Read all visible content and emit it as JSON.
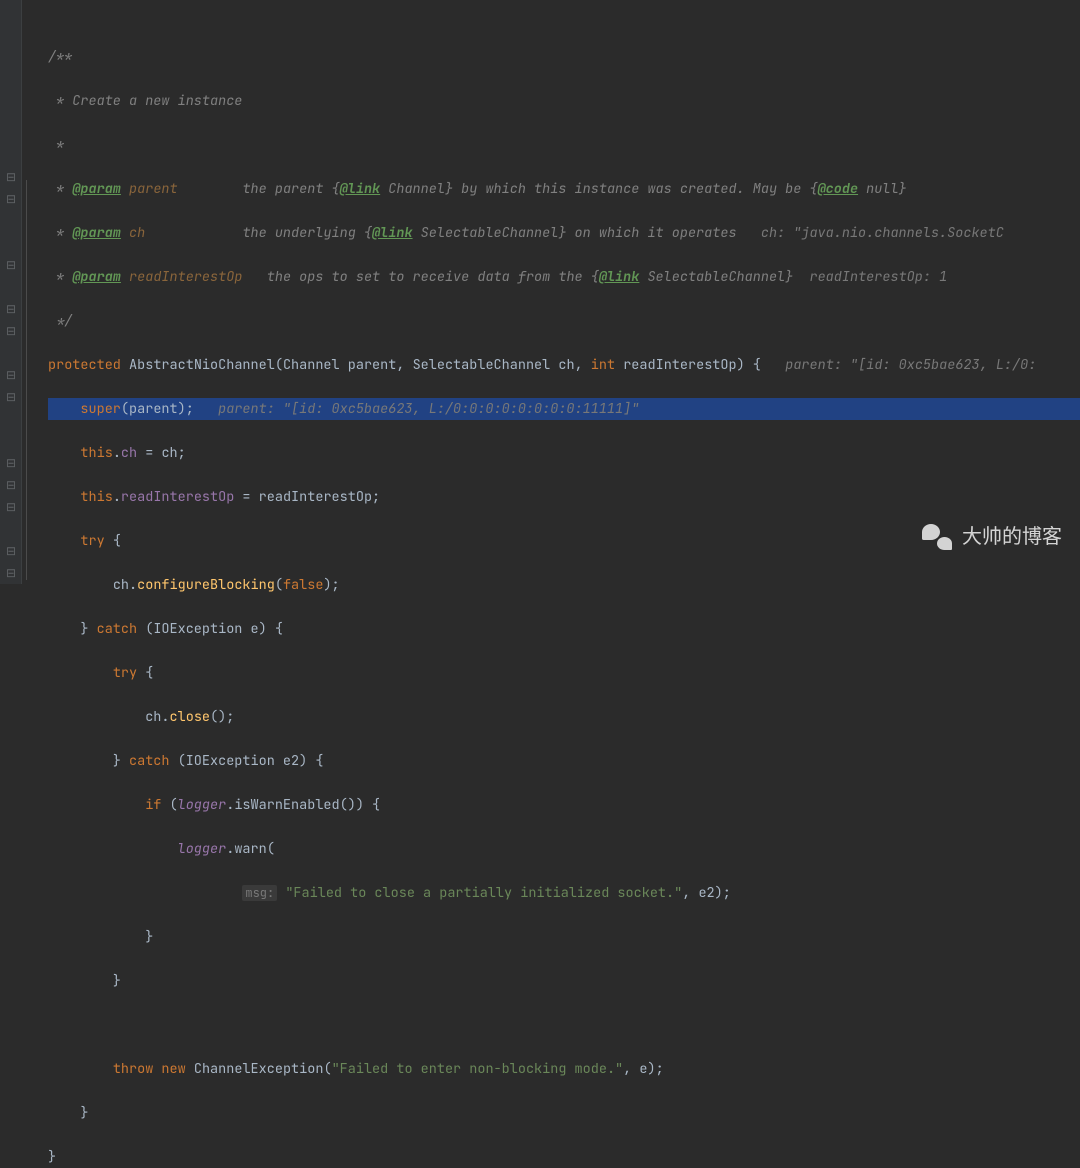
{
  "comment": {
    "open": "/**",
    "line1": " * Create a new instance",
    "blank": " *",
    "p1_tag": "@param",
    "p1_name": "parent",
    "p1_desc_a": "the parent {",
    "p1_link": "@link",
    "p1_desc_b": " Channel} by which this instance was created. May be {",
    "p1_code": "@code",
    "p1_desc_c": " null}",
    "p2_name": "ch",
    "p2_desc_a": "the underlying {",
    "p2_link": "@link",
    "p2_desc_b": " SelectableChannel} on which it operates",
    "p2_hint": "ch: \"java.nio.channels.SocketC",
    "p3_name": "readInterestOp",
    "p3_desc_a": "the ops to set to receive data from the {",
    "p3_link": "@link",
    "p3_desc_b": " SelectableChannel}",
    "p3_hint": "readInterestOp: 1",
    "close": " */"
  },
  "code": {
    "kw_protected": "protected",
    "ctor": "AbstractNioChannel",
    "param1_type": "Channel",
    "param1_name": "parent",
    "param2_type": "SelectableChannel",
    "param2_name": "ch",
    "param3_type": "int",
    "param3_name": "readInterestOp",
    "sig_hint": "parent: \"[id: 0xc5bae623, L:/0:",
    "kw_super": "super",
    "super_arg": "parent",
    "super_hint": "parent: \"[id: 0xc5bae623, L:/0:0:0:0:0:0:0:0:11111]\"",
    "kw_this": "this",
    "field_ch": "ch",
    "field_rio": "readInterestOp",
    "kw_try": "try",
    "m_configureBlocking": "configureBlocking",
    "kw_false": "false",
    "kw_catch": "catch",
    "exc1_type": "IOException",
    "exc1_name": "e",
    "m_close": "close",
    "exc2_type": "IOException",
    "exc2_name": "e2",
    "kw_if": "if",
    "logger": "logger",
    "m_isWarn": "isWarnEnabled",
    "m_warn": "warn",
    "msg_label": "msg:",
    "msg_str": "\"Failed to close a partially initialized socket.\"",
    "arg_e2": "e2",
    "kw_throw": "throw",
    "kw_new": "new",
    "exc_chan": "ChannelException",
    "throw_str": "\"Failed to enter non-blocking mode.\"",
    "arg_e": "e"
  },
  "watermark": "大帅的博客"
}
